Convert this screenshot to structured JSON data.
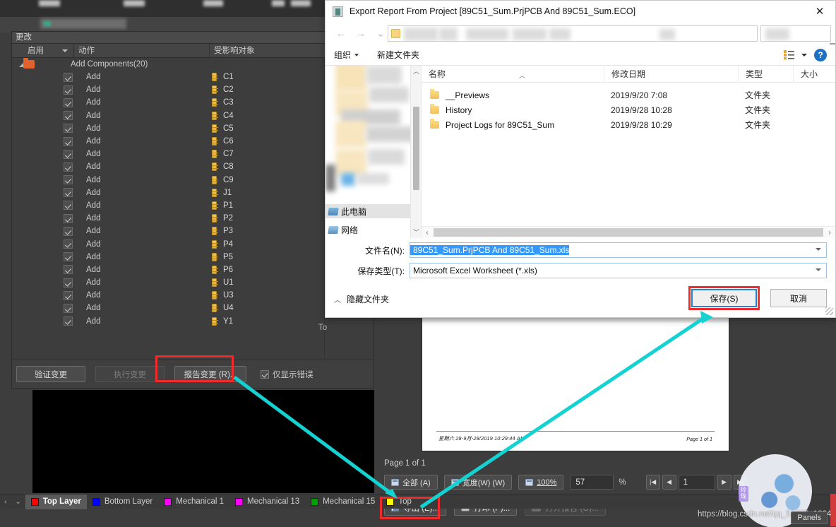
{
  "app": {
    "eco_panel": {
      "header_label": "更改",
      "columns": {
        "enable": "启用",
        "action": "动作",
        "affected": "受影响对象",
        "to": "To"
      },
      "group_label": "Add Components(20)",
      "action_label": "Add",
      "designators": [
        "C1",
        "C2",
        "C3",
        "C4",
        "C5",
        "C6",
        "C7",
        "C8",
        "C9",
        "J1",
        "P1",
        "P2",
        "P3",
        "P4",
        "P5",
        "P6",
        "U1",
        "U3",
        "U4",
        "Y1"
      ],
      "buttons": {
        "validate": "验证变更",
        "execute": "执行变更",
        "report": "报告变更 (R)..."
      },
      "only_errors": "仅显示错误"
    },
    "pcb": {
      "designator": "89C51_Sum"
    },
    "preview": {
      "page_status": "Page 1 of 1",
      "doc_footer_left": "星期六 28-9月-28/2019  10:29:44 AM",
      "doc_footer_right": "Page 1 of 1",
      "toolbar": {
        "fit_all": "全部 (A)",
        "fit_width": "宽度(W) (W)",
        "zoom_100": "100%",
        "zoom_value": "57",
        "percent_symbol": "%",
        "page_value": "1",
        "nav_first": "|◀",
        "nav_prev": "◀",
        "nav_next": "▶",
        "nav_last": "▶|"
      }
    },
    "bottom_actions": {
      "export": "导出 (E)...",
      "print": "打印 (P)...",
      "open_report": "打开报告 (O)..."
    },
    "layer_bar": {
      "scroll_left": "‹",
      "dropdown": "⌄",
      "tabs": [
        {
          "label": "Top Layer",
          "color": "#ff0000",
          "active": true
        },
        {
          "label": "Bottom Layer",
          "color": "#0000ff",
          "active": false
        },
        {
          "label": "Mechanical 1",
          "color": "#ff00ff",
          "active": false
        },
        {
          "label": "Mechanical 13",
          "color": "#ff00ff",
          "active": false
        },
        {
          "label": "Mechanical 15",
          "color": "#00a000",
          "active": false
        },
        {
          "label": "Top",
          "color": "#ffff00",
          "active": false
        }
      ]
    },
    "panels_button": "Panels",
    "watermark": {
      "url": "https://blog.csdn.net/qq_51835_1824",
      "tag": "玲\n珑"
    }
  },
  "save_dialog": {
    "title": "Export Report From Project [89C51_Sum.PrjPCB And 89C51_Sum.ECO]",
    "close_glyph": "✕",
    "nav": {
      "back": "←",
      "forward": "→",
      "recent": "⌄",
      "up": "↑"
    },
    "command_bar": {
      "organize": "组织",
      "new_folder": "新建文件夹"
    },
    "nav_pane": {
      "this_pc": "此电脑",
      "network": "网络"
    },
    "file_list": {
      "columns": [
        "名称",
        "修改日期",
        "类型",
        "大小"
      ],
      "rows": [
        {
          "name": "__Previews",
          "date": "2019/9/20 7:08",
          "type": "文件夹",
          "size": ""
        },
        {
          "name": "History",
          "date": "2019/9/28 10:28",
          "type": "文件夹",
          "size": ""
        },
        {
          "name": "Project Logs for 89C51_Sum",
          "date": "2019/9/28 10:29",
          "type": "文件夹",
          "size": ""
        }
      ]
    },
    "fields": {
      "filename_label": "文件名(N):",
      "filename_value": "89C51_Sum.PrjPCB And 89C51_Sum.xls",
      "filetype_label": "保存类型(T):",
      "filetype_value": "Microsoft Excel Worksheet (*.xls)"
    },
    "hide_folders": "隐藏文件夹",
    "hide_folders_chevron": "︿",
    "save_button": "保存(S)",
    "cancel_button": "取消"
  }
}
